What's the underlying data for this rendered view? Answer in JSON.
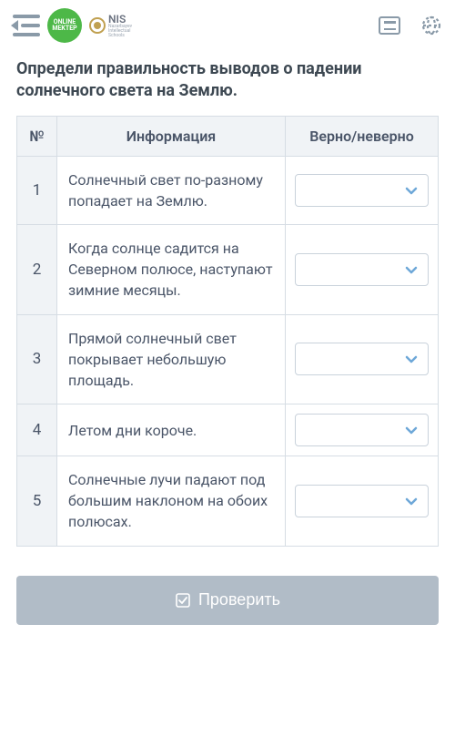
{
  "logo": {
    "line1": "ONLINE",
    "line2": "MEKTEP",
    "nis": "NIS",
    "nis_sub1": "Nazarbayev",
    "nis_sub2": "Intellectual",
    "nis_sub3": "Schools"
  },
  "question": {
    "title": "Определи правильность выводов о падении солнечного света на Землю."
  },
  "table": {
    "headers": {
      "num": "№",
      "info": "Информация",
      "tf": "Верно/неверно"
    },
    "rows": [
      {
        "n": "1",
        "text": "Солнечный свет по-разному попадает на Землю."
      },
      {
        "n": "2",
        "text": "Когда солнце садится на Северном полюсе, наступают зимние месяцы."
      },
      {
        "n": "3",
        "text": "Прямой солнечный свет покрывает небольшую площадь."
      },
      {
        "n": "4",
        "text": "Летом дни короче."
      },
      {
        "n": "5",
        "text": "Солнечные лучи падают под большим наклоном на обоих полюсах."
      }
    ]
  },
  "buttons": {
    "check": "Проверить"
  }
}
